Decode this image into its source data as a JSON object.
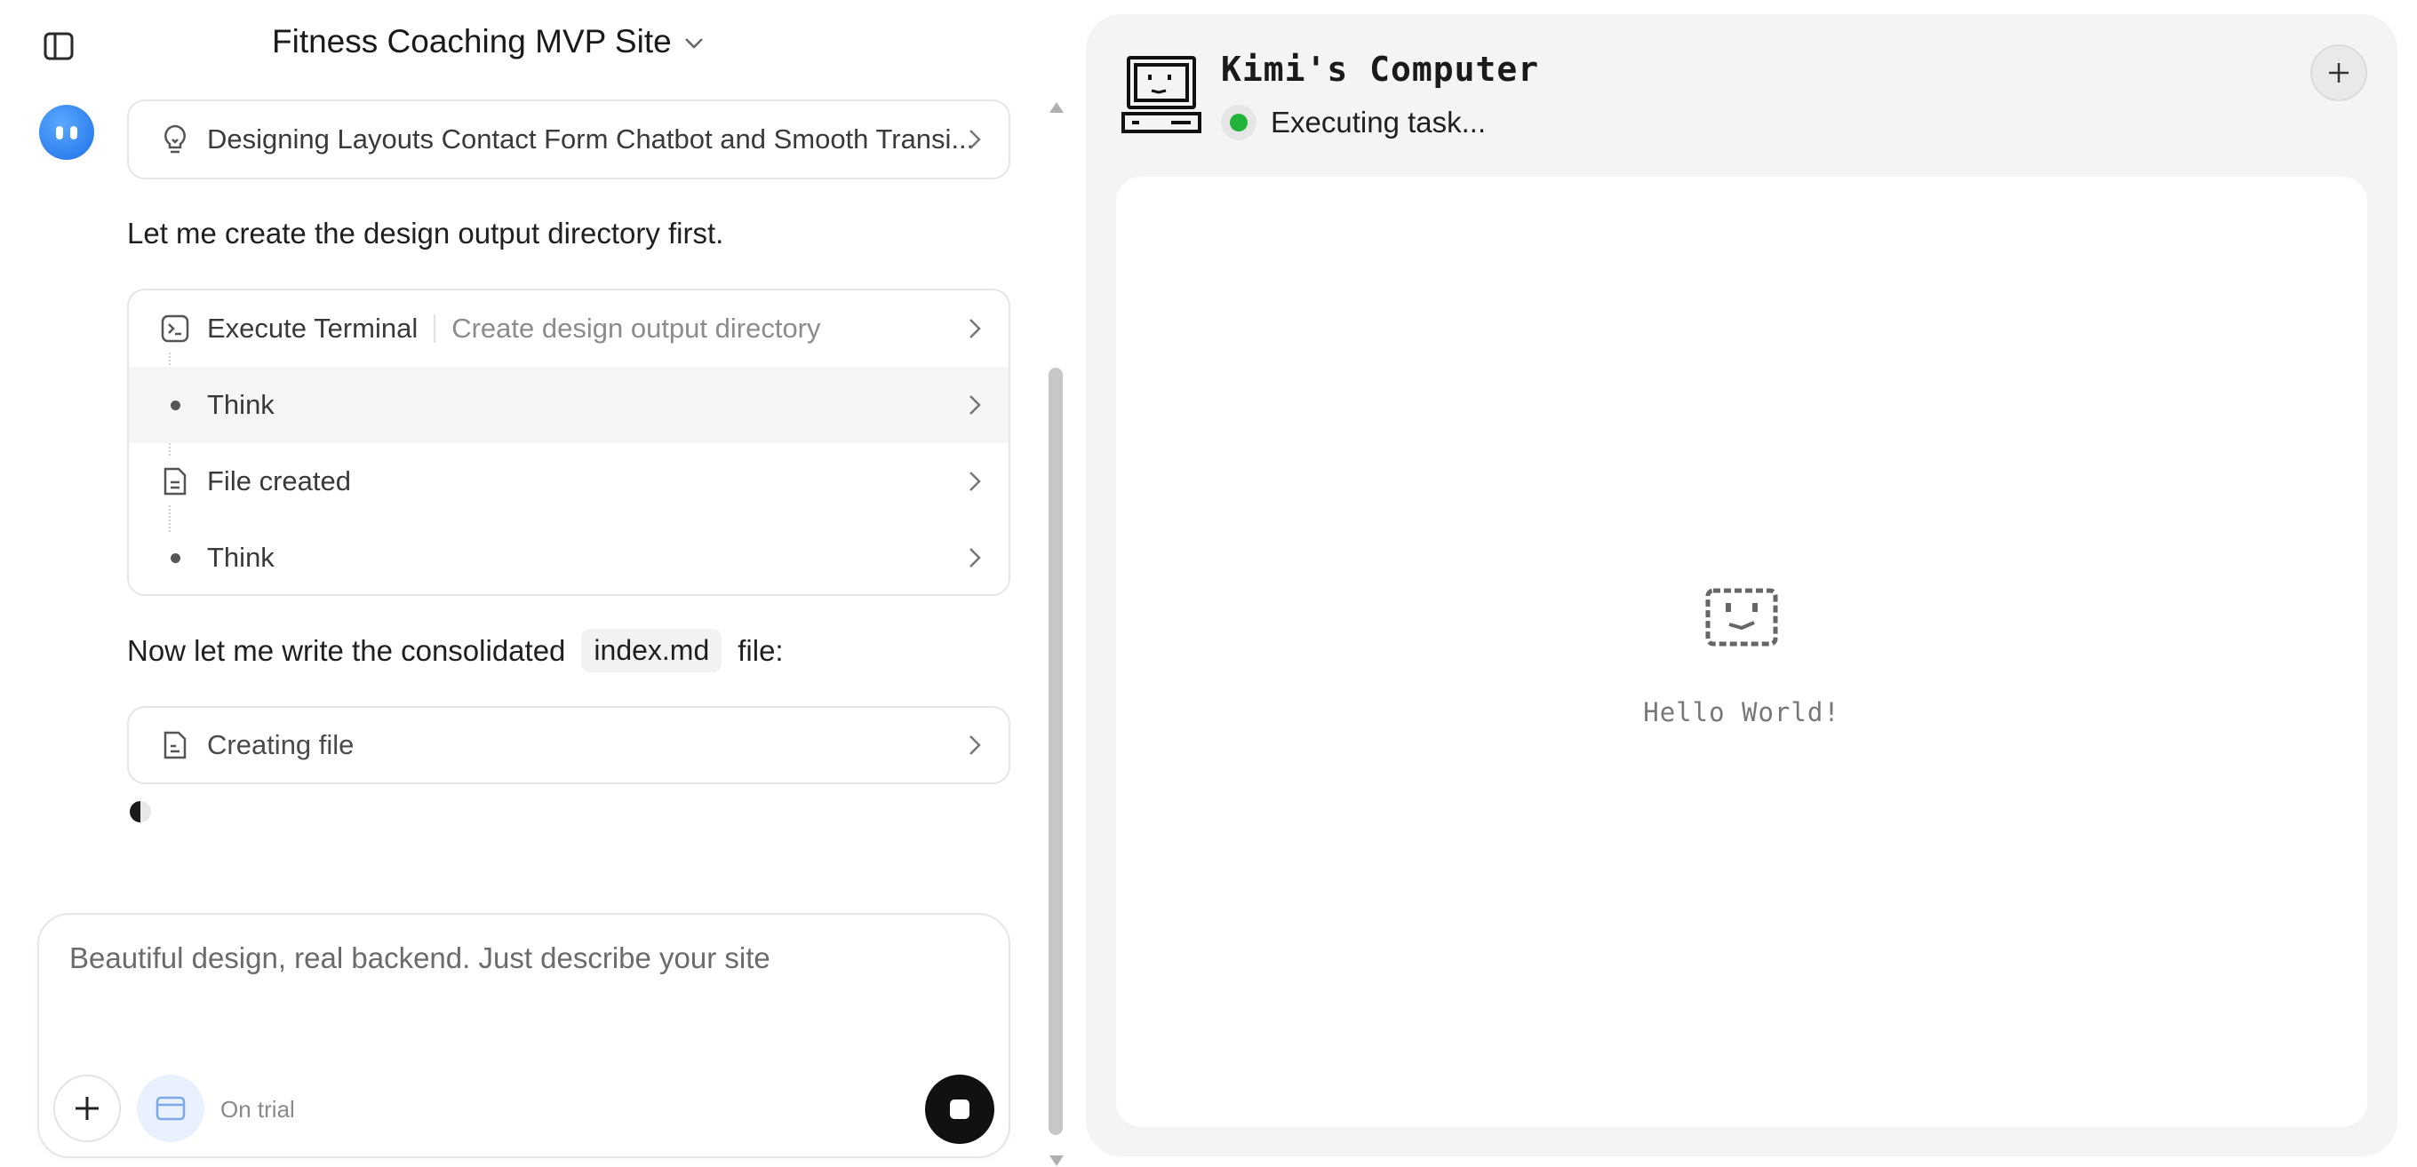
{
  "header": {
    "title": "Fitness Coaching MVP Site"
  },
  "conversation": {
    "thinking_card_label": "Designing Layouts Contact Form Chatbot and Smooth Transi...",
    "message_1": "Let me create the design output directory first.",
    "steps": [
      {
        "label": "Execute Terminal",
        "detail": "Create design output directory"
      },
      {
        "label": "Think"
      },
      {
        "label": "File created"
      },
      {
        "label": "Think"
      }
    ],
    "message_2_before": "Now let me write the consolidated",
    "message_2_code": "index.md",
    "message_2_after": "file:",
    "creating_card_label": "Creating file"
  },
  "composer": {
    "placeholder": "Beautiful design, real backend. Just describe your site",
    "trial_label": "On trial"
  },
  "computer": {
    "title": "Kimi's Computer",
    "status": "Executing task...",
    "status_color": "#22b33a",
    "screen_text": "Hello World!"
  }
}
